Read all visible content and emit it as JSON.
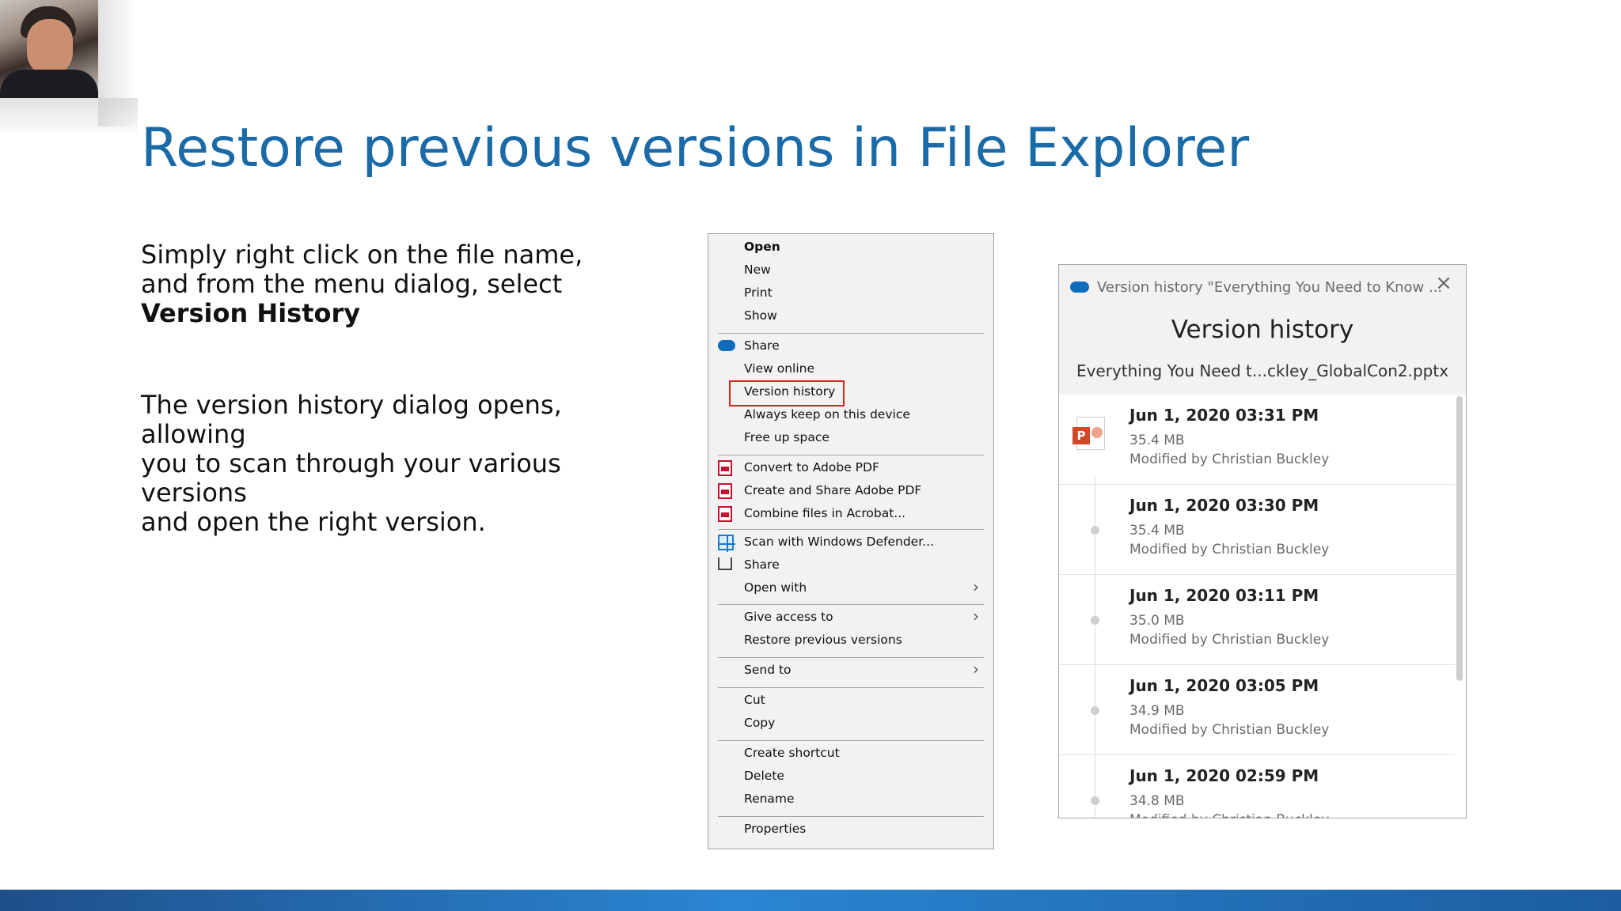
{
  "slide": {
    "title": "Restore previous versions in File Explorer",
    "para1_line1": "Simply right click on the file name,",
    "para1_line2": "and from the menu dialog, select",
    "para1_bold": "Version History",
    "para2_line1": "The version history dialog opens, allowing",
    "para2_line2": "you to scan through your various versions",
    "para2_line3": "and open the right version."
  },
  "context_menu": {
    "items": [
      {
        "label": "Open",
        "bold": true
      },
      {
        "label": "New"
      },
      {
        "label": "Print"
      },
      {
        "label": "Show"
      },
      {
        "label": "Share",
        "icon": "onedrive-cloud-icon"
      },
      {
        "label": "View online"
      },
      {
        "label": "Version history",
        "highlighted": true
      },
      {
        "label": "Always keep on this device"
      },
      {
        "label": "Free up space"
      },
      {
        "label": "Convert to Adobe PDF",
        "icon": "adobe-pdf-icon"
      },
      {
        "label": "Create and Share Adobe PDF",
        "icon": "adobe-pdf-icon"
      },
      {
        "label": "Combine files in Acrobat...",
        "icon": "acrobat-combine-icon"
      },
      {
        "label": "Scan with Windows Defender...",
        "icon": "windows-defender-icon"
      },
      {
        "label": "Share",
        "icon": "share-icon"
      },
      {
        "label": "Open with",
        "submenu": true
      },
      {
        "label": "Give access to",
        "submenu": true
      },
      {
        "label": "Restore previous versions"
      },
      {
        "label": "Send to",
        "submenu": true
      },
      {
        "label": "Cut"
      },
      {
        "label": "Copy"
      },
      {
        "label": "Create shortcut"
      },
      {
        "label": "Delete"
      },
      {
        "label": "Rename"
      },
      {
        "label": "Properties"
      }
    ],
    "highlight_color": "#e01e1e"
  },
  "version_dialog": {
    "window_title": "Version history \"Everything You Need to Know ...",
    "heading": "Version history",
    "file_name": "Everything You Need t...ckley_GlobalCon2.pptx",
    "entries": [
      {
        "datetime": "Jun  1, 2020 03:31 PM",
        "size": "35.4 MB",
        "modified_by": "Modified by Christian Buckley"
      },
      {
        "datetime": "Jun  1, 2020 03:30 PM",
        "size": "35.4 MB",
        "modified_by": "Modified by Christian Buckley"
      },
      {
        "datetime": "Jun  1, 2020 03:11 PM",
        "size": "35.0 MB",
        "modified_by": "Modified by Christian Buckley"
      },
      {
        "datetime": "Jun  1, 2020 03:05 PM",
        "size": "34.9 MB",
        "modified_by": "Modified by Christian Buckley"
      },
      {
        "datetime": "Jun  1, 2020 02:59 PM",
        "size": "34.8 MB",
        "modified_by": "Modified by Christian Buckley"
      }
    ]
  },
  "colors": {
    "title_blue": "#1a6aa8",
    "onedrive_blue": "#0f6cbd",
    "bottom_bar": "#2a86d3"
  }
}
